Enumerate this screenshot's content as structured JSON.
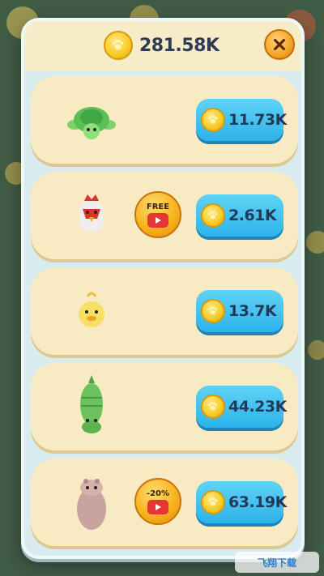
{
  "balance": {
    "amount": "281.58K",
    "icon": "paw-coin-icon"
  },
  "close": {
    "icon": "close-icon"
  },
  "shop_items": [
    {
      "animal": "turtle",
      "price": "11.73K",
      "ad_badge": null
    },
    {
      "animal": "chicken",
      "price": "2.61K",
      "ad_badge": "FREE"
    },
    {
      "animal": "duck",
      "price": "13.7K",
      "ad_badge": null
    },
    {
      "animal": "crocodile",
      "price": "44.23K",
      "ad_badge": null
    },
    {
      "animal": "hippo",
      "price": "63.19K",
      "ad_badge": "-20%"
    }
  ],
  "ad_badges": {
    "free_label": "FREE",
    "discount_label": "-20%"
  },
  "watermark": {
    "text": "飞翔下载"
  },
  "colors": {
    "panel_bg": "#d8ecef",
    "card_bg": "#f8eac2",
    "buy_button": "#2db3ea",
    "coin": "#f8cd2a",
    "ad_button": "#f8b31f",
    "close_button": "#f4a525"
  }
}
